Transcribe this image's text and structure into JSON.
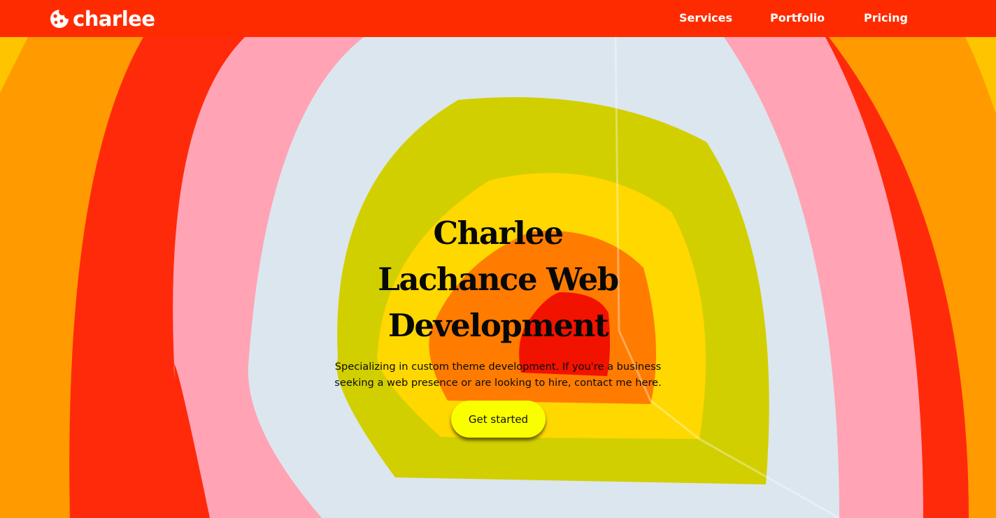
{
  "header": {
    "brand": {
      "logo_icon": "cookie-icon",
      "name": "charlee"
    },
    "nav": {
      "services": "Services",
      "portfolio": "Portfolio",
      "pricing": "Pricing"
    }
  },
  "hero": {
    "title": "Charlee Lachance Web Development",
    "subtitle": "Specializing in custom theme development. If you're a business seeking a web presence or are looking to hire, contact me here.",
    "cta_label": "Get started"
  },
  "colors": {
    "header_bg": "#ff2b00",
    "nav_text": "#ffffff",
    "cta_bg": "#faff00",
    "ring_orange": "#ff9a00",
    "ring_red": "#ff2a0a",
    "ring_pink": "#ffa3b5",
    "ring_pale_blue": "#dce6ee",
    "ring_olive": "#d2cf00",
    "ring_yellow": "#ffd800",
    "ring_inner_orange": "#ff7c00",
    "ring_core_red": "#f21200"
  }
}
